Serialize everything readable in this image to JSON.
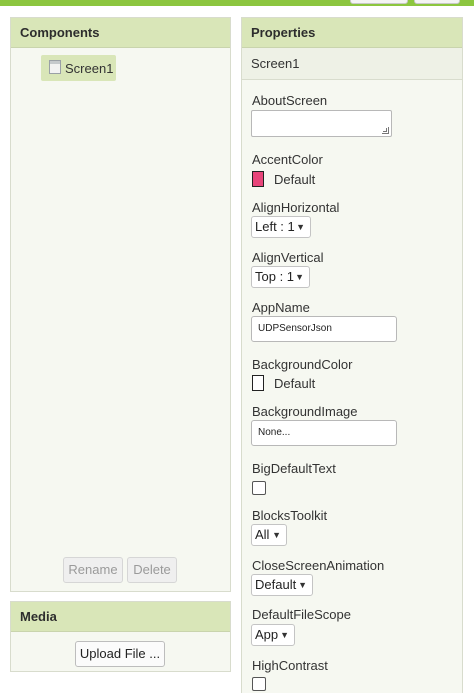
{
  "components_panel": {
    "title": "Components",
    "tree": [
      {
        "label": "Screen1"
      }
    ],
    "rename_label": "Rename",
    "delete_label": "Delete"
  },
  "media_panel": {
    "title": "Media",
    "upload_label": "Upload File ..."
  },
  "properties_panel": {
    "title": "Properties",
    "selected_component": "Screen1",
    "about_screen": {
      "label": "AboutScreen",
      "value": ""
    },
    "accent_color": {
      "label": "AccentColor",
      "value": "Default",
      "swatch": "#e8457a"
    },
    "align_horizontal": {
      "label": "AlignHorizontal",
      "value": "Left : 1"
    },
    "align_vertical": {
      "label": "AlignVertical",
      "value": "Top : 1"
    },
    "app_name": {
      "label": "AppName",
      "value": "UDPSensorJson"
    },
    "background_color": {
      "label": "BackgroundColor",
      "value": "Default",
      "swatch": "#ffffff"
    },
    "background_image": {
      "label": "BackgroundImage",
      "value": "None..."
    },
    "big_default_text": {
      "label": "BigDefaultText",
      "checked": false
    },
    "blocks_toolkit": {
      "label": "BlocksToolkit",
      "value": "All"
    },
    "close_screen_animation": {
      "label": "CloseScreenAnimation",
      "value": "Default"
    },
    "default_file_scope": {
      "label": "DefaultFileScope",
      "value": "App"
    },
    "high_contrast": {
      "label": "HighContrast",
      "checked": false
    }
  },
  "colors": {
    "accent_green": "#8cc63f",
    "header_bg": "#d9e6b8",
    "panel_bg": "#f6f8f1"
  }
}
